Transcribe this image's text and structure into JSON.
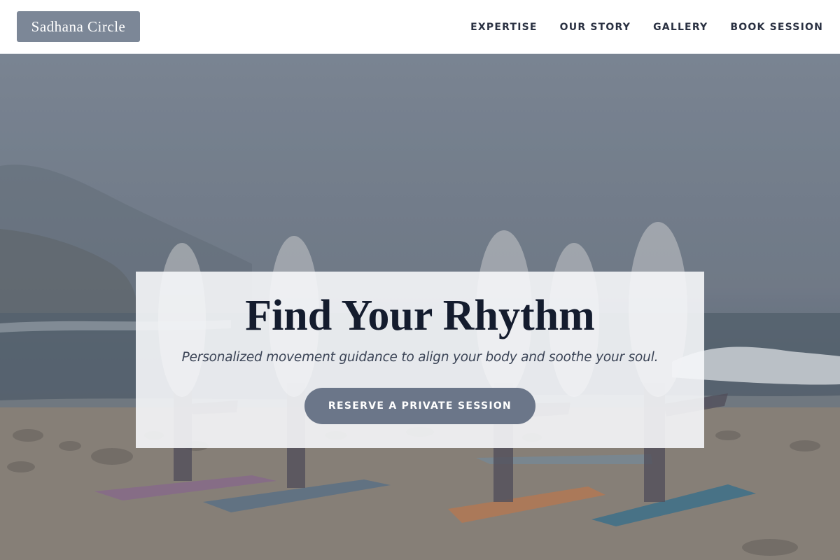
{
  "header": {
    "logo": "Sadhana Circle",
    "nav": [
      "EXPERTISE",
      "OUR STORY",
      "GALLERY",
      "BOOK SESSION"
    ]
  },
  "hero": {
    "title": "Find Your Rhythm",
    "subtitle": "Personalized movement guidance to align your body and soothe your soul.",
    "cta_label": "RESERVE A PRIVATE SESSION"
  },
  "colors": {
    "logo_bg": "#7c8797",
    "nav_text": "#2a3142",
    "title_text": "#141c2e",
    "cta_bg": "#6b7689",
    "card_bg": "#f6f7f9"
  },
  "background_image": "beach-yoga-photo"
}
